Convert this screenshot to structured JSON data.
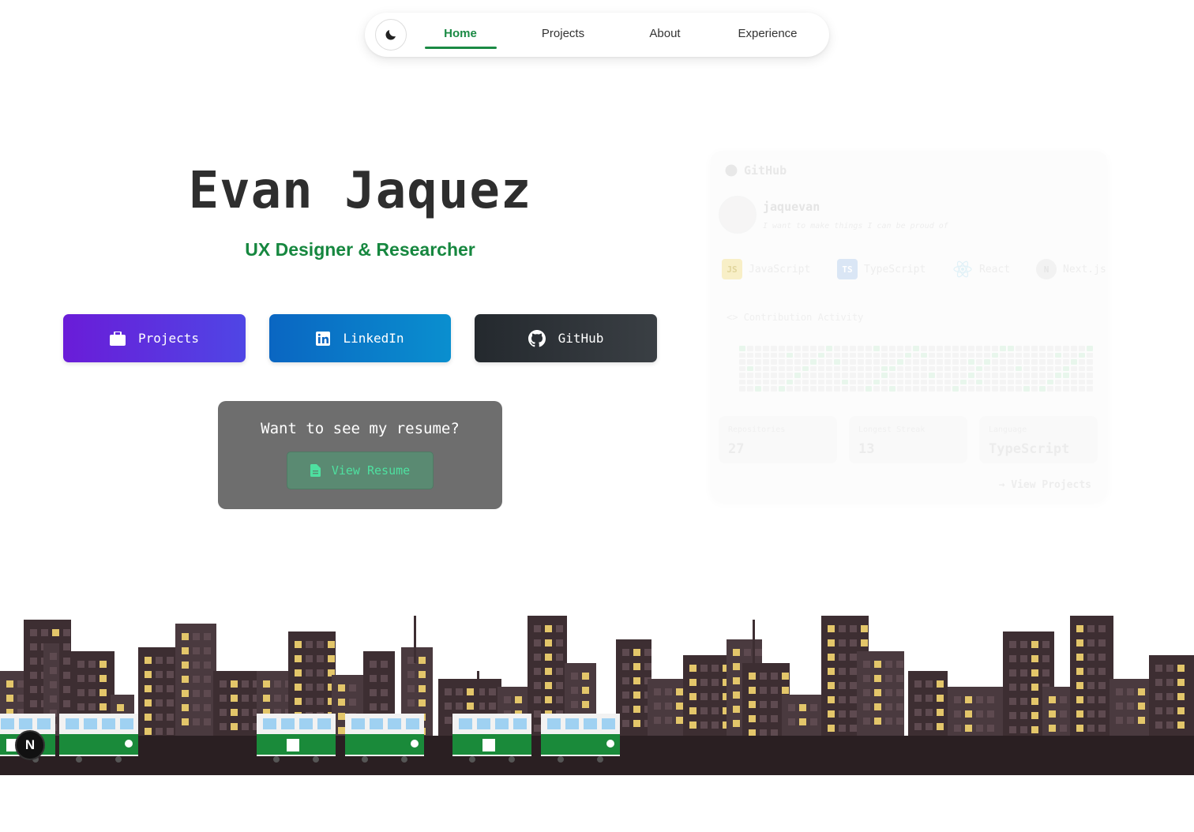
{
  "nav": {
    "theme_icon": "moon-icon",
    "links": [
      {
        "label": "Home",
        "active": true
      },
      {
        "label": "Projects",
        "active": false
      },
      {
        "label": "About",
        "active": false
      },
      {
        "label": "Experience",
        "active": false
      }
    ]
  },
  "hero": {
    "name": "Evan Jaquez",
    "role": "UX Designer & Researcher"
  },
  "buttons": {
    "projects": {
      "label": "Projects",
      "icon": "briefcase-icon"
    },
    "linkedin": {
      "label": "LinkedIn",
      "icon": "linkedin-icon"
    },
    "github": {
      "label": "GitHub",
      "icon": "github-icon"
    }
  },
  "resume": {
    "question": "Want to see my resume?",
    "button_label": "View Resume",
    "icon": "document-icon"
  },
  "github_card": {
    "title": "GitHub",
    "username": "jaquevan",
    "bio": "I want to make things I can be proud of",
    "languages": [
      {
        "name": "JavaScript",
        "badge": "JS"
      },
      {
        "name": "TypeScript",
        "badge": "TS"
      },
      {
        "name": "React",
        "badge": ""
      },
      {
        "name": "Next.js",
        "badge": "N"
      }
    ],
    "contribution_title": "Contribution Activity",
    "stats": [
      {
        "label": "Repositories",
        "value": "27"
      },
      {
        "label": "Longest Streak",
        "value": "13"
      },
      {
        "label": "Language",
        "value": "TypeScript"
      }
    ],
    "view_link": "→ View Projects"
  },
  "colors": {
    "accent_green": "#16873f",
    "projects_btn": "#6a1cd8",
    "linkedin_btn": "#0a66c2",
    "github_btn": "#24292e",
    "train_green": "#1a8a3a",
    "building_dark": "#3d2e32"
  },
  "footer": {
    "next_badge": "N"
  }
}
